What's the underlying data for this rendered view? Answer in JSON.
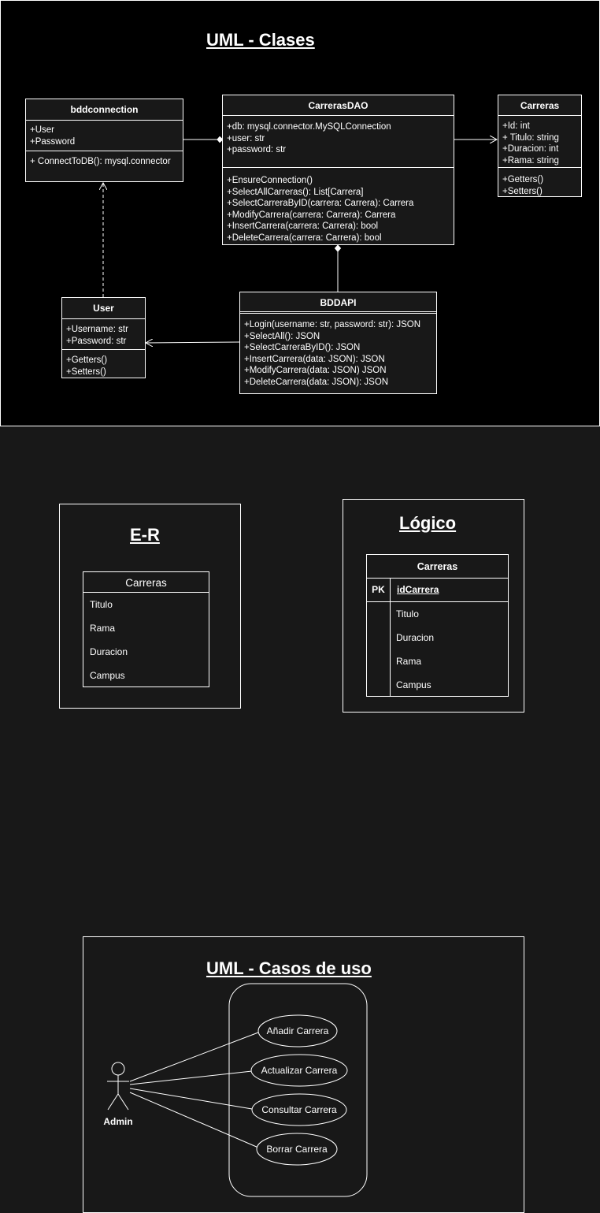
{
  "colors": {
    "background": "#181818",
    "frame_background": "#000000",
    "line": "#ffffff",
    "text": "#ffffff"
  },
  "uml_classes": {
    "title": "UML - Clases",
    "bddconnection": {
      "name": "bddconnection",
      "attributes": [
        "+User",
        "+Password"
      ],
      "methods": [
        "+ ConnectToDB(): mysql.connector"
      ]
    },
    "carrerasdao": {
      "name": "CarrerasDAO",
      "attributes": [
        "+db: mysql.connector.MySQLConnection",
        "+user: str",
        "+password: str"
      ],
      "methods": [
        "+EnsureConnection()",
        "+SelectAllCarreras(): List[Carrera]",
        "+SelectCarreraByID(carrera: Carrera): Carrera",
        "+ModifyCarrera(carrera: Carrera): Carrera",
        "+InsertCarrera(carrera: Carrera): bool",
        "+DeleteCarrera(carrera: Carrera): bool"
      ]
    },
    "carreras": {
      "name": "Carreras",
      "attributes": [
        "+Id: int",
        "+ Titulo: string",
        "+Duracion: int",
        "+Rama: string"
      ],
      "methods": [
        "+Getters()",
        "+Setters()"
      ]
    },
    "user": {
      "name": "User",
      "attributes": [
        "+Username: str",
        "+Password: str"
      ],
      "methods": [
        "+Getters()",
        "+Setters()"
      ]
    },
    "bddapi": {
      "name": "BDDAPI",
      "methods": [
        "+Login(username: str, password: str): JSON",
        "+SelectAll(): JSON",
        "+SelectCarreraByID(): JSON",
        "+InsertCarrera(data: JSON): JSON",
        "+ModifyCarrera(data: JSON) JSON",
        "+DeleteCarrera(data: JSON): JSON"
      ]
    }
  },
  "er": {
    "title": "E-R",
    "entity": "Carreras",
    "attributes": [
      "Titulo",
      "Rama",
      "Duracion",
      "Campus"
    ]
  },
  "logico": {
    "title": "Lógico",
    "table": "Carreras",
    "pk_label": "PK",
    "pk_field": "idCarrera",
    "fields": [
      "Titulo",
      "Duracion",
      "Rama",
      "Campus"
    ]
  },
  "use_cases": {
    "title": "UML - Casos de uso",
    "actor": "Admin",
    "cases": [
      "Añadir Carrera",
      "Actualizar Carrera",
      "Consultar Carrera",
      "Borrar Carrera"
    ]
  }
}
